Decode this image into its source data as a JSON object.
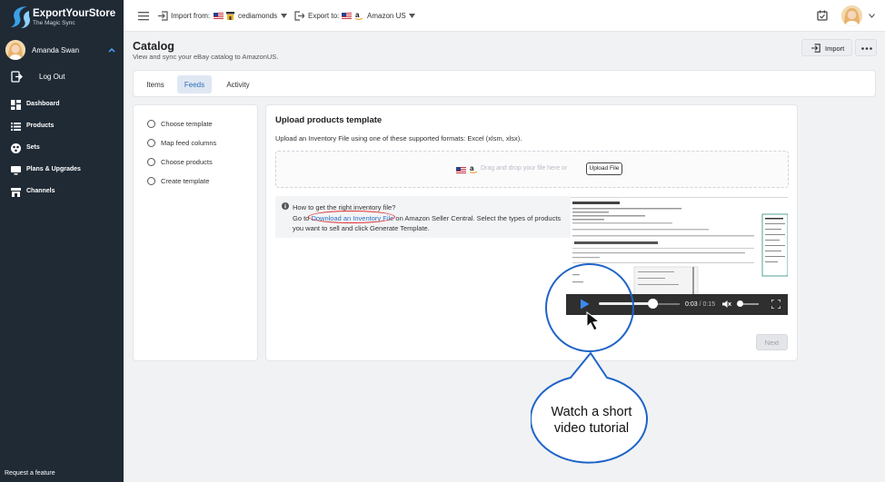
{
  "sidebar": {
    "logo_title": "ExportYourStore",
    "logo_subtitle": "The Magic Sync",
    "user_name": "Amanda Swan",
    "logout_label": "Log Out",
    "nav": [
      {
        "label": "Dashboard",
        "icon": "dashboard-icon"
      },
      {
        "label": "Products",
        "icon": "list-icon"
      },
      {
        "label": "Sets",
        "icon": "sets-icon"
      },
      {
        "label": "Plans & Upgrades",
        "icon": "monitor-icon"
      },
      {
        "label": "Channels",
        "icon": "store-icon"
      }
    ],
    "request_feature": "Request a feature"
  },
  "topbar": {
    "import_label": "Import from:",
    "import_store": "cediamonds",
    "export_label": "Export to:",
    "export_store": "Amazon US"
  },
  "header": {
    "title": "Catalog",
    "subtitle": "View and sync your eBay catalog to AmazonUS.",
    "import_button": "Import"
  },
  "tabs": [
    "Items",
    "Feeds",
    "Activity"
  ],
  "active_tab": "Feeds",
  "steps": [
    "Choose template",
    "Map feed columns",
    "Choose products",
    "Create template"
  ],
  "upload": {
    "title": "Upload products template",
    "description": "Upload an Inventory File using one of these supported formats: Excel (xlsm, xlsx).",
    "dropzone_text": "Drag and drop your file here or",
    "upload_button": "Upload File"
  },
  "info": {
    "question": "How to get the right inventory file?",
    "line2_prefix": "Go to ",
    "link": "Download an Inventory File",
    "line2_suffix": " on Amazon Seller Central. Select the types of products",
    "line3": "you want to sell and click Generate Template."
  },
  "video": {
    "current_time": "0:03",
    "separator": " / ",
    "duration": "0:15",
    "progress": 0.2
  },
  "next_button": "Next",
  "callout": {
    "line1": "Watch a short",
    "line2": "video tutorial"
  },
  "colors": {
    "sidebar_bg": "#1f2a35",
    "accent_blue": "#2d6fb8",
    "callout_blue": "#1e63c8",
    "highlight_red": "#d33333"
  }
}
